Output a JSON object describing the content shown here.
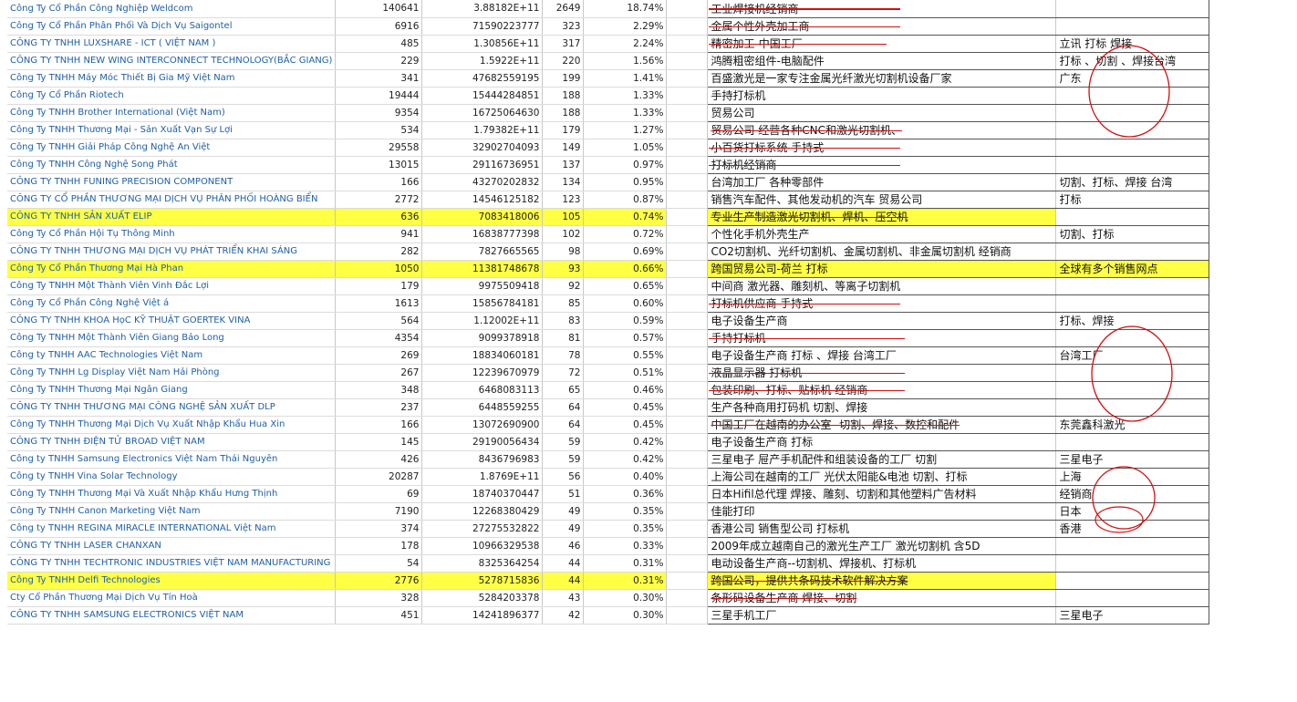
{
  "rows": [
    {
      "name": "Công Ty Cổ Phần Công Nghiệp Weldcom",
      "a": "140641",
      "b": "3.88182E+11",
      "c": "2649",
      "d": "18.74%",
      "desc": "工业焊接机经销商",
      "note": "",
      "strike": true,
      "ext": 210
    },
    {
      "name": "Công Ty Cổ Phần Phân Phối Và Dịch Vụ Saigontel",
      "a": "6916",
      "b": "71590223777",
      "c": "323",
      "d": "2.29%",
      "desc": "金属个性外壳加工商",
      "note": "",
      "strike": true,
      "ext": 210
    },
    {
      "name": "CÔNG TY TNHH LUXSHARE - ICT ( VIỆT NAM )",
      "a": "485",
      "b": "1.30856E+11",
      "c": "317",
      "d": "2.24%",
      "desc": "精密加工-中国工厂",
      "note": "立讯 打标  焊接",
      "strike": true,
      "ext": 195
    },
    {
      "name": "CÔNG TY TNHH NEW WING INTERCONNECT TECHNOLOGY(BẮC GIANG)",
      "a": "229",
      "b": "1.5922E+11",
      "c": "220",
      "d": "1.56%",
      "desc": "鸿腾粗密组件-电脑配件",
      "note": "打标  、切割   、焊接台湾",
      "strike": false
    },
    {
      "name": "Công Ty TNHH Máy Móc Thiết Bị Gia Mỹ Việt Nam",
      "a": "341",
      "b": "47682559195",
      "c": "199",
      "d": "1.41%",
      "desc": "百盛激光是一家专注金属光纤激光切割机设备厂家",
      "note": "广东",
      "strike": false
    },
    {
      "name": "Công Ty Cổ Phần Riotech",
      "a": "19444",
      "b": "15444284851",
      "c": "188",
      "d": "1.33%",
      "desc": "手持打标机",
      "note": "",
      "strike": false
    },
    {
      "name": "Công Ty TNHH Brother International (Việt Nam)",
      "a": "9354",
      "b": "16725064630",
      "c": "188",
      "d": "1.33%",
      "desc": "贸易公司",
      "note": "",
      "strike": false
    },
    {
      "name": "Công Ty TNHH Thương Mại - Sản Xuất Vạn Sự Lợi",
      "a": "534",
      "b": "1.79382E+11",
      "c": "179",
      "d": "1.27%",
      "desc": "贸易公司    经营各种CNC和激光切割机、",
      "note": "",
      "strike": true,
      "ext": 0
    },
    {
      "name": "Công Ty TNHH Giải Pháp Công Nghệ An Việt",
      "a": "29558",
      "b": "32902704093",
      "c": "149",
      "d": "1.05%",
      "desc": "小百货打标系统  手持式",
      "note": "",
      "strike": true,
      "ext": 210
    },
    {
      "name": "Công Ty TNHH Công Nghệ Song Phát",
      "a": "13015",
      "b": "29116736951",
      "c": "137",
      "d": "0.97%",
      "desc": "打标机经销商",
      "note": "",
      "strike": true,
      "ext": 210
    },
    {
      "name": "CÔNG TY TNHH FUNING PRECISION COMPONENT",
      "a": "166",
      "b": "43270202832",
      "c": "134",
      "d": "0.95%",
      "desc": "台湾加工厂   各种零部件",
      "note": "切割、打标、焊接  台湾",
      "strike": false
    },
    {
      "name": "CÔNG TY CỔ PHẦN THƯƠNG MẠI DỊCH VỤ PHÂN PHỐI HOÀNG BIỂN",
      "a": "2772",
      "b": "14546125182",
      "c": "123",
      "d": "0.87%",
      "desc": "销售汽车配件、其他发动机的汽车  贸易公司",
      "note": "打标",
      "strike": false
    },
    {
      "name": "CÔNG TY TNHH SẢN XUẤT ELIP",
      "a": "636",
      "b": "7083418006",
      "c": "105",
      "d": "0.74%",
      "desc": "专业生产制造激光切割机、焊机、压空机",
      "note": "",
      "strike": true,
      "ext": 0,
      "hl": true
    },
    {
      "name": "Công Ty Cổ Phần Hội Tụ Thông Minh",
      "a": "941",
      "b": "16838777398",
      "c": "102",
      "d": "0.72%",
      "desc": "个性化手机外壳生产",
      "note": "切割、打标",
      "strike": false
    },
    {
      "name": "CÔNG TY TNHH THƯƠNG MẠI DỊCH VỤ PHÁT TRIỂN KHAI SÁNG",
      "a": "282",
      "b": "7827665565",
      "c": "98",
      "d": "0.69%",
      "desc": "CO2切割机、光纤切割机、金属切割机、非金属切割机 经销商",
      "note": "",
      "strike": false
    },
    {
      "name": "Công Ty Cổ Phần Thương Mại Hà Phan",
      "a": "1050",
      "b": "11381748678",
      "c": "93",
      "d": "0.66%",
      "desc": "跨国贸易公司-荷兰    打标",
      "note": "全球有多个销售网点",
      "strike": false,
      "hl": true,
      "hlnote": true
    },
    {
      "name": "Công Ty TNHH Một Thành Viên Vinh Đắc Lợi",
      "a": "179",
      "b": "9975509418",
      "c": "92",
      "d": "0.65%",
      "desc": "中间商  激光器、雕刻机、等离子切割机",
      "note": "",
      "strike": false
    },
    {
      "name": "Công Ty Cổ Phần Công Nghệ Việt á",
      "a": "1613",
      "b": "15856784181",
      "c": "85",
      "d": "0.60%",
      "desc": "打标机供应商  手持式",
      "note": "",
      "strike": true,
      "ext": 210
    },
    {
      "name": "CÔNG TY TNHH KHOA HọC KỸ THUẬT GOERTEK VINA",
      "a": "564",
      "b": "1.12002E+11",
      "c": "83",
      "d": "0.59%",
      "desc": "电子设备生产商",
      "note": "打标、焊接",
      "strike": false
    },
    {
      "name": "Công Ty TNHH Một Thành Viên Giang Bảo Long",
      "a": "4354",
      "b": "9099378918",
      "c": "81",
      "d": "0.57%",
      "desc": "手持打标机",
      "note": "",
      "strike": true,
      "ext": 215
    },
    {
      "name": "Công ty TNHH AAC Technologies Việt Nam",
      "a": "269",
      "b": "18834060181",
      "c": "78",
      "d": "0.55%",
      "desc": "电子设备生产商  打标  、焊接  台湾工厂",
      "note": "台湾工厂",
      "strike": false
    },
    {
      "name": "Công Ty TNHH Lg Display Việt Nam Hải Phòng",
      "a": "267",
      "b": "12239670979",
      "c": "72",
      "d": "0.51%",
      "desc": "液晶显示器    打标机",
      "note": "",
      "strike": true,
      "ext": 215
    },
    {
      "name": "Công Ty TNHH Thương Mại Ngân Giang",
      "a": "348",
      "b": "6468083113",
      "c": "65",
      "d": "0.46%",
      "desc": "包装印刷、打标、贴标机  经销商",
      "note": "",
      "strike": true,
      "ext": 215
    },
    {
      "name": "CÔNG TY TNHH THƯƠNG MẠI CÔNG NGHỆ SẢN XUẤT DLP",
      "a": "237",
      "b": "6448559255",
      "c": "64",
      "d": "0.45%",
      "desc": "生产各种商用打码机   切割、焊接",
      "note": "",
      "strike": false
    },
    {
      "name": "Công Ty TNHH Thương Mại Dịch Vụ Xuất Nhập Khẩu Hua Xin",
      "a": "166",
      "b": "13072690900",
      "c": "64",
      "d": "0.45%",
      "desc": "中国工厂在越南的办公室--切割、焊接、数控和配件",
      "note": "东莞鑫科激光",
      "strike": true,
      "ext": 0
    },
    {
      "name": "CÔNG TY TNHH ĐIỆN TỬ BROAD VIỆT NAM",
      "a": "145",
      "b": "29190056434",
      "c": "59",
      "d": "0.42%",
      "desc": "电子设备生产商    打标",
      "note": "",
      "strike": false
    },
    {
      "name": "Công ty TNHH Samsung Electronics Việt Nam Thái Nguyên",
      "a": "426",
      "b": "8436796983",
      "c": "59",
      "d": "0.42%",
      "desc": "三星电子    屉产手机配件和组装设备的工厂    切割",
      "note": "三星电子",
      "strike": false
    },
    {
      "name": "Công ty TNHH Vina Solar Technology",
      "a": "20287",
      "b": "1.8769E+11",
      "c": "56",
      "d": "0.40%",
      "desc": "上海公司在越南的工厂  光伏太阳能&电池     切割、打标",
      "note": "上海",
      "strike": false
    },
    {
      "name": "Công Ty TNHH Thương Mại Và Xuất Nhập Khẩu Hưng Thịnh",
      "a": "69",
      "b": "18740370447",
      "c": "51",
      "d": "0.36%",
      "desc": "日本Hifil总代理     焊接、雕刻、切割和其他塑料广告材料",
      "note": "经销商",
      "strike": false
    },
    {
      "name": "Công Ty TNHH Canon Marketing Việt Nam",
      "a": "7190",
      "b": "12268380429",
      "c": "49",
      "d": "0.35%",
      "desc": "佳能打印",
      "note": "日本",
      "strike": false
    },
    {
      "name": "Công ty TNHH REGINA MIRACLE INTERNATIONAL Việt Nam",
      "a": "374",
      "b": "27275532822",
      "c": "49",
      "d": "0.35%",
      "desc": "香港公司  销售型公司  打标机",
      "note": "香港",
      "strike": false
    },
    {
      "name": "CÔNG TY TNHH LASER CHANXAN",
      "a": "178",
      "b": "10966329538",
      "c": "46",
      "d": "0.33%",
      "desc": "2009年成立越南自己的激光生产工厂  激光切割机  含5D",
      "note": "",
      "strike": false
    },
    {
      "name": "CÔNG TY TNHH TECHTRONIC INDUSTRIES VIỆT NAM MANUFACTURING",
      "a": "54",
      "b": "8325364254",
      "c": "44",
      "d": "0.31%",
      "desc": "电动设备生产商--切割机、焊接机、打标机",
      "note": "",
      "strike": false
    },
    {
      "name": "Công Ty TNHH Delfi Technologies",
      "a": "2776",
      "b": "5278715836",
      "c": "44",
      "d": "0.31%",
      "desc": "跨国公司，提供共条码技术软件解决方案",
      "note": "",
      "strike": true,
      "ext": 0,
      "hl": true
    },
    {
      "name": "Cty Cổ Phần Thương Mại Dịch Vụ Tín Hoà",
      "a": "328",
      "b": "5284203378",
      "c": "43",
      "d": "0.30%",
      "desc": "条形码设备生产商    焊接、切割",
      "note": "",
      "strike": true,
      "ext": 0
    },
    {
      "name": "CÔNG TY TNHH SAMSUNG ELECTRONICS VIỆT NAM",
      "a": "451",
      "b": "14241896377",
      "c": "42",
      "d": "0.30%",
      "desc": "三星手机工厂",
      "note": "三星电子",
      "strike": false
    }
  ],
  "colors": {
    "highlight": "#ffff44",
    "annotation": "#d01010",
    "link": "#1f5fa8"
  }
}
